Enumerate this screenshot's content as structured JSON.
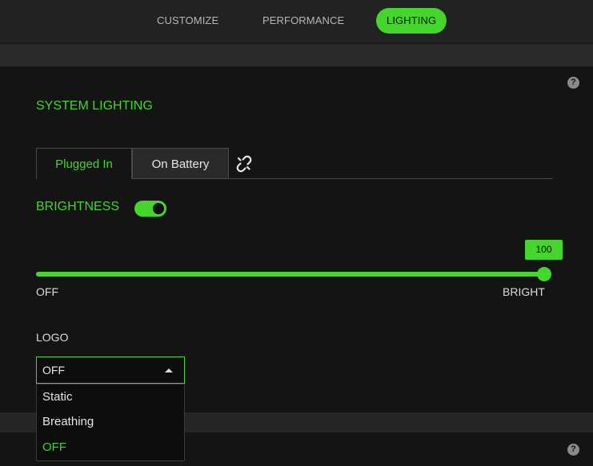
{
  "top_tabs": [
    {
      "label": "CUSTOMIZE",
      "active": false
    },
    {
      "label": "PERFORMANCE",
      "active": false
    },
    {
      "label": "LIGHTING",
      "active": true
    }
  ],
  "help_glyph": "?",
  "section": {
    "title": "SYSTEM LIGHTING"
  },
  "power_tabs": [
    {
      "label": "Plugged In",
      "selected": true
    },
    {
      "label": "On Battery",
      "selected": false
    }
  ],
  "brightness": {
    "label": "BRIGHTNESS",
    "enabled": true,
    "value": "100",
    "value_fraction": 1.0,
    "min_label": "OFF",
    "max_label": "BRIGHT"
  },
  "logo": {
    "label": "LOGO",
    "selected": "OFF",
    "options": [
      {
        "label": "Static",
        "selected": false
      },
      {
        "label": "Breathing",
        "selected": false
      },
      {
        "label": "OFF",
        "selected": true
      }
    ]
  },
  "colors": {
    "accent": "#44d62c",
    "panel": "#141414",
    "background": "#262626"
  },
  "icons": [
    "help-icon",
    "unlink-icon",
    "toggle-switch",
    "caret-up-icon"
  ]
}
